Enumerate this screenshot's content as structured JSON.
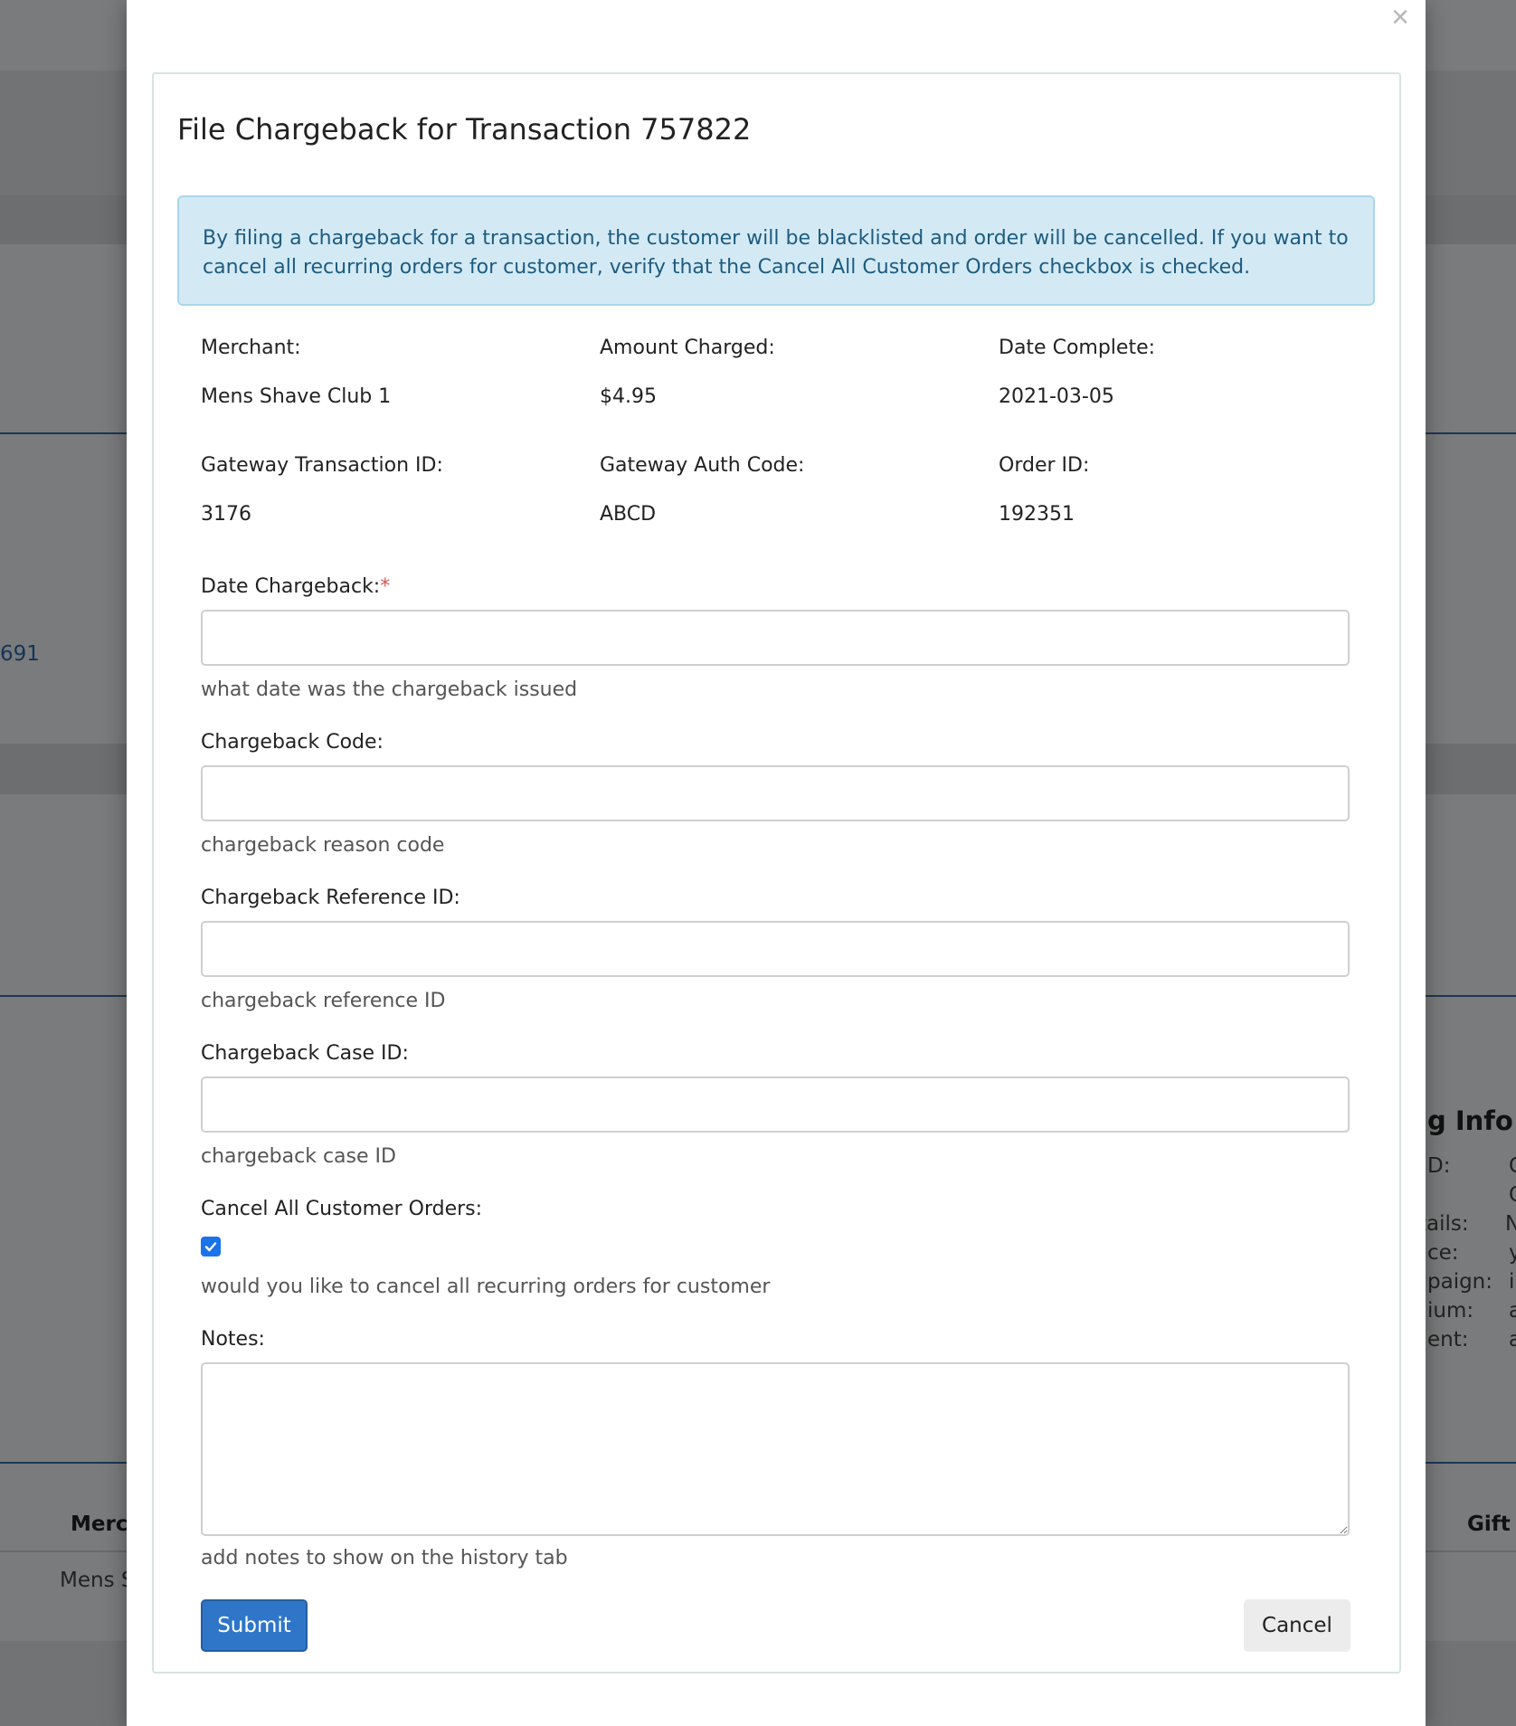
{
  "background": {
    "link_fragment": "691",
    "info_heading": "g Info :",
    "info_rows": [
      "D:",
      "tails:",
      "ce:",
      "paign:",
      "ium:",
      "ent:"
    ],
    "info_values": [
      "C",
      "C",
      "N",
      "y",
      "i",
      "a",
      "a"
    ],
    "table_header_left": "Merch",
    "table_header_right": "Gift C",
    "table_cell_left": "Mens S"
  },
  "modal": {
    "close_icon": "×",
    "title": "File Chargeback for Transaction 757822",
    "alert_text": "By filing a chargeback for a transaction, the customer will be blacklisted and order will be cancelled. If you want to cancel all recurring orders for customer, verify that the Cancel All Customer Orders checkbox is checked.",
    "info": {
      "merchant_label": "Merchant:",
      "merchant_value": "Mens Shave Club 1",
      "amount_label": "Amount Charged:",
      "amount_value": "$4.95",
      "date_label": "Date Complete:",
      "date_value": "2021-03-05",
      "gateway_txn_label": "Gateway Transaction ID:",
      "gateway_txn_value": "3176",
      "gateway_auth_label": "Gateway Auth Code:",
      "gateway_auth_value": "ABCD",
      "order_label": "Order ID:",
      "order_value": "192351"
    },
    "form": {
      "date_chargeback_label": "Date Chargeback:",
      "required_mark": "*",
      "date_chargeback_value": "",
      "date_chargeback_help": "what date was the chargeback issued",
      "code_label": "Chargeback Code:",
      "code_value": "",
      "code_help": "chargeback reason code",
      "reference_label": "Chargeback Reference ID:",
      "reference_value": "",
      "reference_help": "chargeback reference ID",
      "case_label": "Chargeback Case ID:",
      "case_value": "",
      "case_help": "chargeback case ID",
      "cancel_all_label": "Cancel All Customer Orders:",
      "cancel_all_checked": true,
      "cancel_all_help": "would you like to cancel all recurring orders for customer",
      "notes_label": "Notes:",
      "notes_value": "",
      "notes_help": "add notes to show on the history tab"
    },
    "buttons": {
      "submit_label": "Submit",
      "cancel_label": "Cancel"
    }
  },
  "colors": {
    "primary": "#2f76c8",
    "alert_bg": "#d3eaf5",
    "alert_text": "#1d5b80",
    "required": "#d9534f",
    "checkbox": "#1a73e8"
  }
}
